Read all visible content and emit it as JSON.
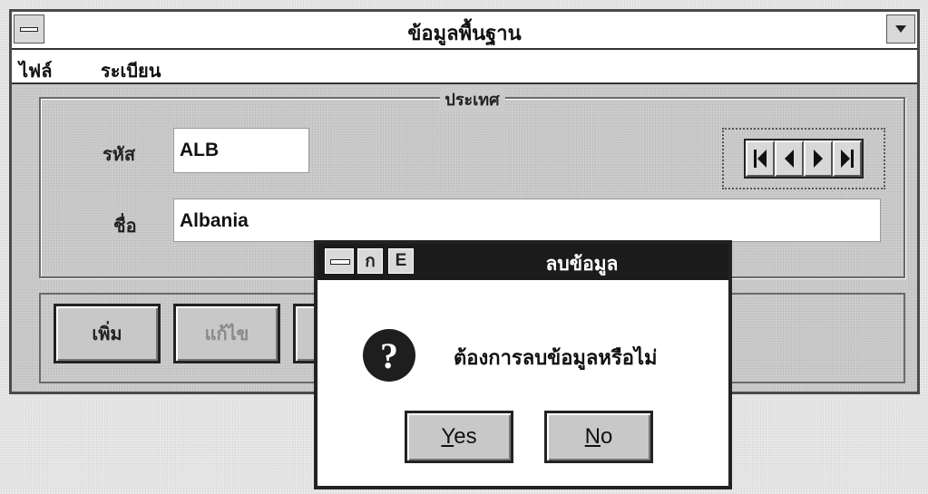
{
  "window": {
    "title": "ข้อมูลพื้นฐาน",
    "menu": [
      "ไฟล์",
      "ระเบียน"
    ]
  },
  "form": {
    "group_title": "ประเทศ",
    "code_label": "รหัส",
    "code_value": "ALB",
    "name_label": "ชื่อ",
    "name_value": "Albania"
  },
  "navigator": {
    "icons": [
      "first-record-icon",
      "previous-record-icon",
      "next-record-icon",
      "last-record-icon"
    ]
  },
  "buttons": {
    "add": "เพิ่ม",
    "edit": "แก้ไข"
  },
  "dialog": {
    "title": "ลบข้อมูล",
    "message": "ต้องการลบข้อมูลหรือไม่",
    "yes_mnemonic": "Y",
    "yes_rest": "es",
    "no_mnemonic": "N",
    "no_rest": "o",
    "icons": [
      "control-menu-icon",
      "thai-char-icon",
      "e-char-icon",
      "question-icon"
    ]
  }
}
